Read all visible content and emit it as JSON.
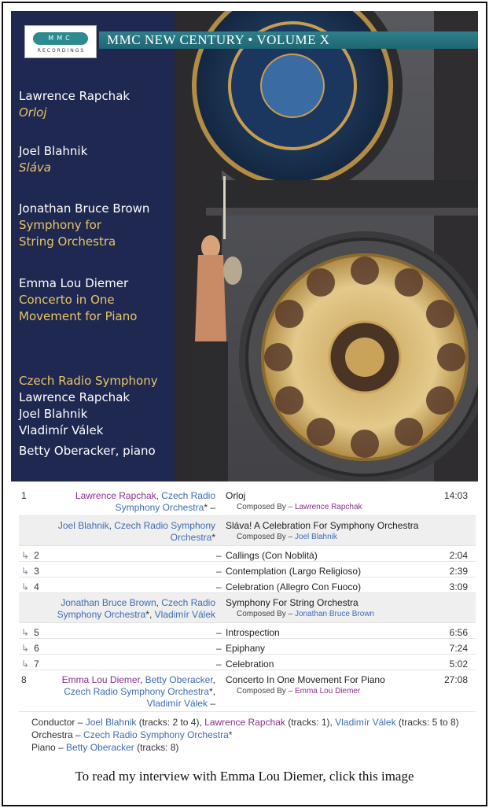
{
  "cover": {
    "logo_main": "MMC",
    "logo_sub": "RECORDINGS",
    "banner": "MMC NEW CENTURY • VOLUME X",
    "works": [
      {
        "composer": "Lawrence Rapchak",
        "work_lines": [
          "Orloj"
        ],
        "italic": true
      },
      {
        "composer": "Joel Blahnik",
        "work_lines": [
          "Sláva"
        ],
        "italic": true
      },
      {
        "composer": "Jonathan Bruce Brown",
        "work_lines": [
          "Symphony for",
          "String Orchestra"
        ],
        "italic": false
      },
      {
        "composer": "Emma Lou Diemer",
        "work_lines": [
          "Concerto in One",
          "Movement for Piano"
        ],
        "italic": false
      }
    ],
    "orchestra": "Czech Radio Symphony",
    "conductors": [
      "Lawrence Rapchak",
      "Joel Blahnik",
      "Vladimír Válek"
    ],
    "soloist": "Betty Oberacker, piano",
    "colors": {
      "panel": "#1f2850",
      "gold": "#e8c566",
      "banner": "#2e7f8c"
    }
  },
  "tracks": [
    {
      "position": "1",
      "sub": false,
      "grey": false,
      "artist_lines": [
        [
          {
            "text": "Lawrence Rapchak",
            "c": "purple"
          },
          {
            "text": ", ",
            "c": "plain"
          },
          {
            "text": "Czech Radio",
            "c": "blue"
          }
        ],
        [
          {
            "text": "Symphony Orchestra",
            "c": "blue"
          },
          {
            "text": "* –",
            "c": "plain"
          }
        ]
      ],
      "title": "Orloj",
      "credit_label": "Composed By –",
      "credit_name": "Lawrence Rapchak",
      "credit_color": "purple",
      "duration": "14:03"
    },
    {
      "position": "",
      "sub": false,
      "grey": true,
      "artist_lines": [
        [
          {
            "text": "Joel Blahnik",
            "c": "blue"
          },
          {
            "text": ", ",
            "c": "plain"
          },
          {
            "text": "Czech Radio Symphony",
            "c": "blue"
          }
        ],
        [
          {
            "text": "Orchestra",
            "c": "blue"
          },
          {
            "text": "*",
            "c": "plain"
          }
        ]
      ],
      "title": "Sláva! A Celebration For Symphony Orchestra",
      "credit_label": "Composed By –",
      "credit_name": "Joel Blahnik",
      "credit_color": "blue",
      "duration": ""
    },
    {
      "position": "2",
      "sub": true,
      "grey": false,
      "title": "Callings (Con Noblitá)",
      "duration": "2:04"
    },
    {
      "position": "3",
      "sub": true,
      "grey": false,
      "title": "Contemplation (Largo Religioso)",
      "duration": "2:39"
    },
    {
      "position": "4",
      "sub": true,
      "grey": false,
      "title": "Celebration (Allegro Con Fuoco)",
      "duration": "3:09"
    },
    {
      "position": "",
      "sub": false,
      "grey": true,
      "artist_lines": [
        [
          {
            "text": "Jonathan Bruce Brown",
            "c": "blue"
          },
          {
            "text": ", ",
            "c": "plain"
          },
          {
            "text": "Czech Radio",
            "c": "blue"
          }
        ],
        [
          {
            "text": "Symphony Orchestra",
            "c": "blue"
          },
          {
            "text": "*, ",
            "c": "plain"
          },
          {
            "text": "Vladimír Válek",
            "c": "blue"
          }
        ]
      ],
      "title": "Symphony For String Orchestra",
      "credit_label": "Composed By –",
      "credit_name": "Jonathan Bruce Brown",
      "credit_color": "blue",
      "duration": ""
    },
    {
      "position": "5",
      "sub": true,
      "grey": false,
      "title": "Introspection",
      "duration": "6:56"
    },
    {
      "position": "6",
      "sub": true,
      "grey": false,
      "title": "Epiphany",
      "duration": "7:24"
    },
    {
      "position": "7",
      "sub": true,
      "grey": false,
      "title": "Celebration",
      "duration": "5:02"
    },
    {
      "position": "8",
      "sub": false,
      "grey": false,
      "artist_lines": [
        [
          {
            "text": "Emma Lou Diemer",
            "c": "purple"
          },
          {
            "text": ", ",
            "c": "plain"
          },
          {
            "text": "Betty Oberacker",
            "c": "blue"
          },
          {
            "text": ",",
            "c": "plain"
          }
        ],
        [
          {
            "text": "Czech Radio Symphony Orchestra",
            "c": "blue"
          },
          {
            "text": "*,",
            "c": "plain"
          }
        ],
        [
          {
            "text": "Vladimír Válek",
            "c": "blue"
          },
          {
            "text": " –",
            "c": "plain"
          }
        ]
      ],
      "title": "Concerto In One Movement For Piano",
      "credit_label": "Composed By –",
      "credit_name": "Emma Lou Diemer",
      "credit_color": "purple",
      "duration": "27:08"
    }
  ],
  "sub_arrow": "↳",
  "credits": [
    [
      {
        "text": "Conductor – ",
        "c": "plain"
      },
      {
        "text": "Joel Blahnik",
        "c": "blue"
      },
      {
        "text": " (tracks: 2 to 4), ",
        "c": "plain"
      },
      {
        "text": "Lawrence Rapchak",
        "c": "purple"
      },
      {
        "text": " (tracks: 1), ",
        "c": "plain"
      },
      {
        "text": "Vladimír Válek",
        "c": "blue"
      },
      {
        "text": " (tracks: 5 to 8)",
        "c": "plain"
      }
    ],
    [
      {
        "text": "Orchestra – ",
        "c": "plain"
      },
      {
        "text": "Czech Radio Symphony Orchestra",
        "c": "blue"
      },
      {
        "text": "*",
        "c": "plain"
      }
    ],
    [
      {
        "text": "Piano – ",
        "c": "plain"
      },
      {
        "text": "Betty Oberacker",
        "c": "blue"
      },
      {
        "text": " (tracks: 8)",
        "c": "plain"
      }
    ]
  ],
  "caption": "To read my interview with Emma Lou Diemer, click this image"
}
